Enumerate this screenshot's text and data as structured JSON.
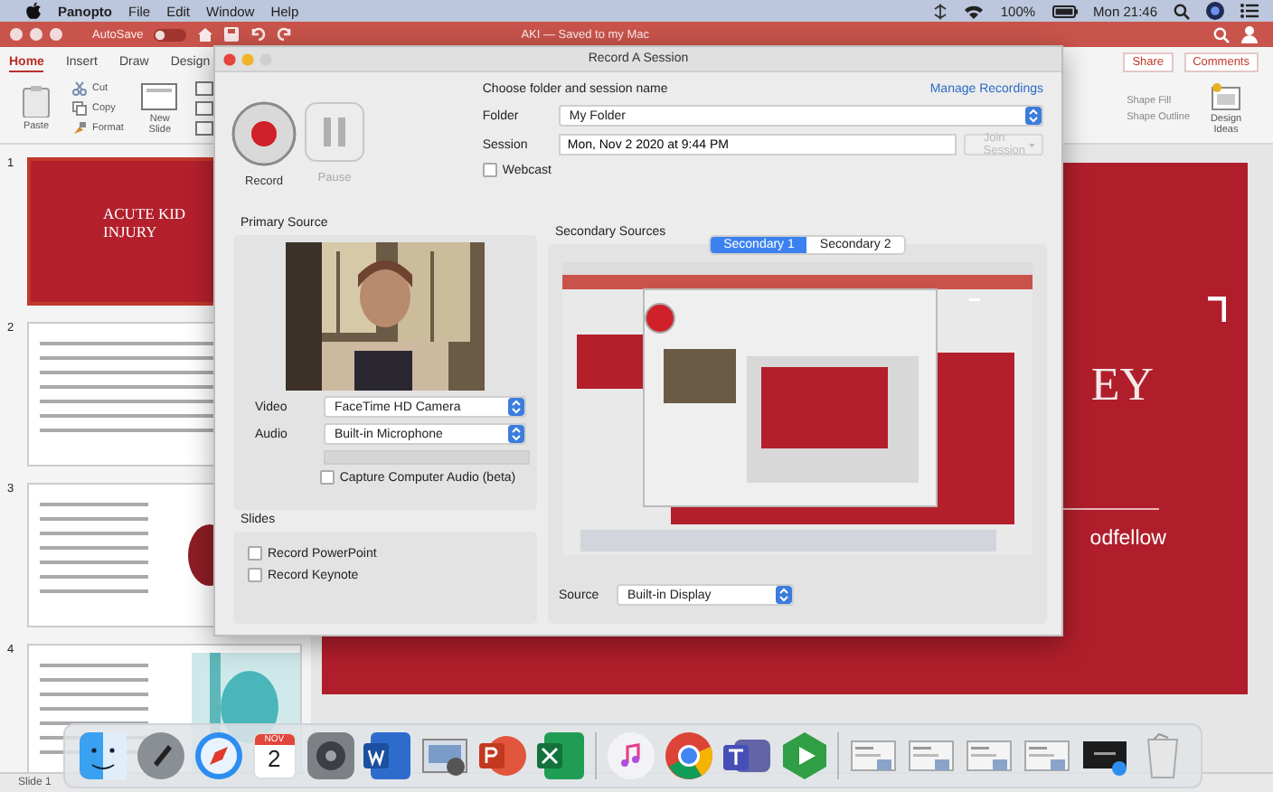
{
  "menu_bar": {
    "app": "Panopto",
    "menus": [
      "File",
      "Edit",
      "Window",
      "Help"
    ],
    "battery": "100%",
    "clock": "Mon 21:46"
  },
  "powerpoint": {
    "autosave": "AutoSave",
    "autosave_on": false,
    "title": "AKI — Saved to my Mac",
    "tabs": [
      {
        "label": "Home",
        "selected": true
      },
      {
        "label": "Insert",
        "selected": false
      },
      {
        "label": "Draw",
        "selected": false
      },
      {
        "label": "Design",
        "selected": false
      }
    ],
    "share": "Share",
    "comments": "Comments",
    "ribbon": {
      "paste": "Paste",
      "cut": "Cut",
      "copy": "Copy",
      "format": "Format",
      "new_slide": "New Slide",
      "shape_fill": "Shape Fill",
      "shape_outline": "Shape Outline",
      "design_ideas": "Design Ideas"
    },
    "slides": [
      {
        "number": "1",
        "selected": true,
        "kind": "title",
        "title": "ACUTE KID",
        "title_2": "INJURY"
      },
      {
        "number": "2",
        "selected": false,
        "kind": "bullets"
      },
      {
        "number": "3",
        "selected": false,
        "kind": "kidney"
      },
      {
        "number": "4",
        "selected": false,
        "kind": "diagram"
      }
    ],
    "current_slide": {
      "title": "EY",
      "subtitle": "odfellow"
    },
    "status": "Slide 1"
  },
  "dialog": {
    "title": "Record A Session",
    "record": "Record",
    "pause": "Pause",
    "choose_label": "Choose folder and session name",
    "manage": "Manage Recordings",
    "folder_label": "Folder",
    "folder": "My Folder",
    "session_label": "Session",
    "session": "Mon, Nov 2 2020 at 9:44 PM",
    "join": "Join Session",
    "webcast": {
      "label": "Webcast",
      "checked": false
    },
    "primary": {
      "heading": "Primary Source",
      "video_label": "Video",
      "video": "FaceTime HD Camera",
      "audio_label": "Audio",
      "audio": "Built-in Microphone",
      "capture_audio": {
        "label": "Capture Computer Audio (beta)",
        "checked": false
      }
    },
    "slides": {
      "heading": "Slides",
      "options": [
        {
          "label": "Record PowerPoint",
          "checked": false
        },
        {
          "label": "Record Keynote",
          "checked": false
        }
      ]
    },
    "secondary": {
      "heading": "Secondary Sources",
      "tabs": [
        {
          "label": "Secondary 1",
          "selected": true
        },
        {
          "label": "Secondary 2",
          "selected": false
        }
      ],
      "source_label": "Source",
      "source": "Built-in Display"
    }
  },
  "dock": [
    {
      "kind": "finder"
    },
    {
      "kind": "launchpad"
    },
    {
      "kind": "safari"
    },
    {
      "kind": "calendar",
      "month": "NOV",
      "day": "2"
    },
    {
      "kind": "settings"
    },
    {
      "kind": "word"
    },
    {
      "kind": "preview"
    },
    {
      "kind": "powerpoint"
    },
    {
      "kind": "excel"
    },
    {
      "kind": "separator"
    },
    {
      "kind": "music"
    },
    {
      "kind": "chrome"
    },
    {
      "kind": "teams"
    },
    {
      "kind": "panopto"
    },
    {
      "kind": "separator"
    },
    {
      "kind": "window"
    },
    {
      "kind": "window"
    },
    {
      "kind": "window"
    },
    {
      "kind": "window"
    },
    {
      "kind": "dark-window"
    },
    {
      "kind": "trash"
    }
  ]
}
